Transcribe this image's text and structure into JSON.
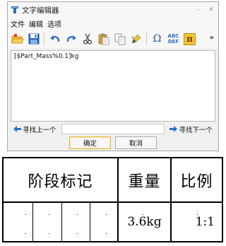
{
  "window": {
    "title": "文字编辑器",
    "minimize_glyph": "–",
    "close_glyph": "✕"
  },
  "menu": {
    "items": [
      "文件",
      "编辑",
      "选项"
    ]
  },
  "toolbar": {
    "items": [
      "open-icon",
      "save-icon",
      "undo-icon",
      "redo-icon",
      "cut-icon",
      "paste-icon",
      "copy-icon",
      "format-brush-icon",
      "omega-icon",
      "abc-def-icon",
      "pi-icon"
    ],
    "omega_label": "Ω",
    "abc_label": "ABC",
    "def_label": "DEF",
    "pi_label": "π",
    "more_label": "»"
  },
  "editor": {
    "content": "[$Part_Mass%0.1]kg"
  },
  "find": {
    "prev_label": "寻找上一个",
    "next_label": "寻找下一个",
    "value": ""
  },
  "dialog_buttons": {
    "ok_label": "确定",
    "cancel_label": "取消"
  },
  "title_block": {
    "header": {
      "stage_label": "阶段标记",
      "weight_label": "重量",
      "scale_label": "比例"
    },
    "values": {
      "weight": "3.6kg",
      "scale": "1:1"
    }
  },
  "colors": {
    "accent_orange": "#e4b33c",
    "undo_blue": "#2a6fc9",
    "save_blue": "#1f5fb8"
  }
}
